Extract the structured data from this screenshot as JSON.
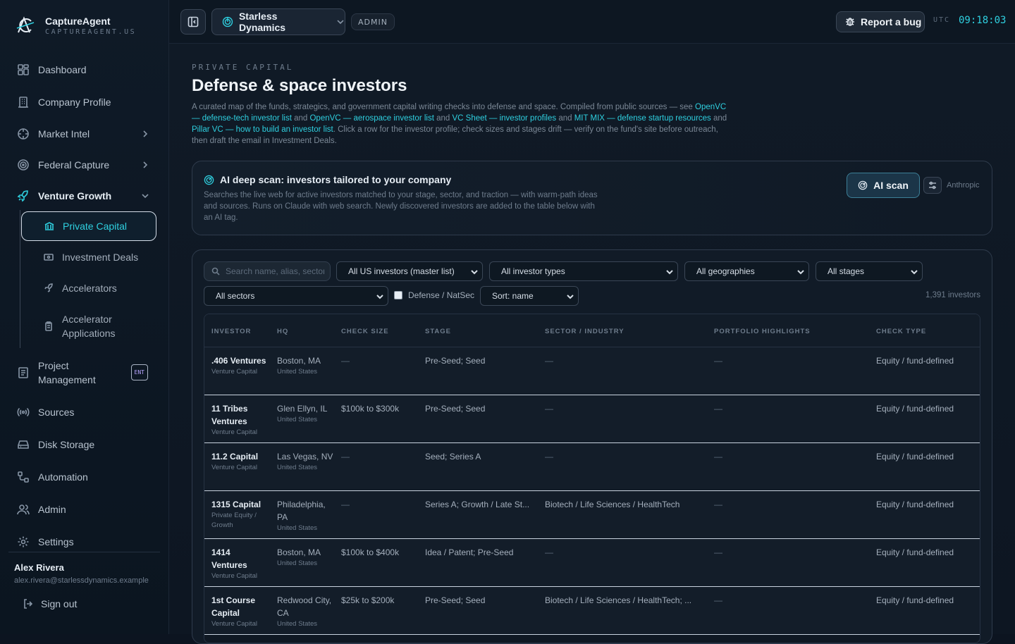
{
  "brand": {
    "name": "CaptureAgent",
    "domain": "CAPTUREAGENT.US"
  },
  "nav": {
    "dashboard": "Dashboard",
    "company_profile": "Company Profile",
    "market_intel": "Market Intel",
    "federal_capture": "Federal Capture",
    "venture_growth": "Venture Growth",
    "sub": {
      "private_capital": "Private Capital",
      "investment_deals": "Investment Deals",
      "accelerators": "Accelerators",
      "accelerator_applications": "Accelerator Applications"
    },
    "project_management": "Project Management",
    "ent_badge": "ENT",
    "sources": "Sources",
    "disk_storage": "Disk Storage",
    "automation": "Automation",
    "admin": "Admin",
    "settings": "Settings"
  },
  "user": {
    "name": "Alex Rivera",
    "email": "alex.rivera@starlessdynamics.example",
    "sign_out": "Sign out"
  },
  "topbar": {
    "org": "Starless Dynamics",
    "role": "ADMIN",
    "report_bug": "Report a bug",
    "utc_label": "UTC",
    "clock": "09:18:03"
  },
  "page": {
    "eyebrow": "PRIVATE CAPITAL",
    "title": "Defense & space investors",
    "desc_1": "A curated map of the funds, strategics, and government capital writing checks into defense and space. Compiled from public sources — see ",
    "link_1": "OpenVC — defense-tech investor list",
    "and_1": " and ",
    "link_2": "OpenVC — aerospace investor list",
    "and_2": " and ",
    "link_3": "VC Sheet — investor profiles",
    "and_3": " and ",
    "link_4": "MIT MIX — defense startup resources",
    "and_4": " and ",
    "link_5": "Pillar VC — how to build an investor list",
    "desc_2": ". Click a row for the investor profile; check sizes and stages drift — verify on the fund's site before outreach, then draft the email in Investment Deals."
  },
  "scan": {
    "title": "AI deep scan: investors tailored to your company",
    "desc": "Searches the live web for active investors matched to your stage, sector, and traction — with warm-path ideas and sources. Runs on Claude with web search. Newly discovered investors are added to the table below with an AI tag.",
    "button": "AI scan",
    "provider": "Anthropic"
  },
  "filters": {
    "search_placeholder": "Search name, alias, sector",
    "list": "All US investors (master list)",
    "types": "All investor types",
    "geos": "All geographies",
    "stages": "All stages",
    "sectors": "All sectors",
    "defense_checkbox": "Defense / NatSec",
    "sort": "Sort: name",
    "count": "1,391 investors"
  },
  "table": {
    "headers": [
      "INVESTOR",
      "HQ",
      "CHECK SIZE",
      "STAGE",
      "SECTOR / INDUSTRY",
      "PORTFOLIO HIGHLIGHTS",
      "CHECK TYPE"
    ],
    "rows": [
      {
        "name": ".406 Ventures",
        "type": "Venture Capital",
        "hq": "Boston, MA",
        "country": "United States",
        "check": "—",
        "stage": "Pre-Seed; Seed",
        "sector": "—",
        "portfolio": "—",
        "check_type": "Equity / fund-defined"
      },
      {
        "name": "11 Tribes Ventures",
        "type": "Venture Capital",
        "hq": "Glen Ellyn, IL",
        "country": "United States",
        "check": "$100k to $300k",
        "stage": "Pre-Seed; Seed",
        "sector": "—",
        "portfolio": "—",
        "check_type": "Equity / fund-defined"
      },
      {
        "name": "11.2 Capital",
        "type": "Venture Capital",
        "hq": "Las Vegas, NV",
        "country": "United States",
        "check": "—",
        "stage": "Seed; Series A",
        "sector": "—",
        "portfolio": "—",
        "check_type": "Equity / fund-defined"
      },
      {
        "name": "1315 Capital",
        "type": "Private Equity / Growth",
        "hq": "Philadelphia, PA",
        "country": "United States",
        "check": "—",
        "stage": "Series A; Growth / Late St...",
        "sector": "Biotech / Life Sciences / HealthTech",
        "portfolio": "—",
        "check_type": "Equity / fund-defined"
      },
      {
        "name": "1414 Ventures",
        "type": "Venture Capital",
        "hq": "Boston, MA",
        "country": "United States",
        "check": "$100k to $400k",
        "stage": "Idea / Patent; Pre-Seed",
        "sector": "—",
        "portfolio": "—",
        "check_type": "Equity / fund-defined"
      },
      {
        "name": "1st Course Capital",
        "type": "Venture Capital",
        "hq": "Redwood City, CA",
        "country": "United States",
        "check": "$25k to $200k",
        "stage": "Pre-Seed; Seed",
        "sector": "Biotech / Life Sciences / HealthTech; ...",
        "portfolio": "—",
        "check_type": "Equity / fund-defined"
      }
    ]
  }
}
